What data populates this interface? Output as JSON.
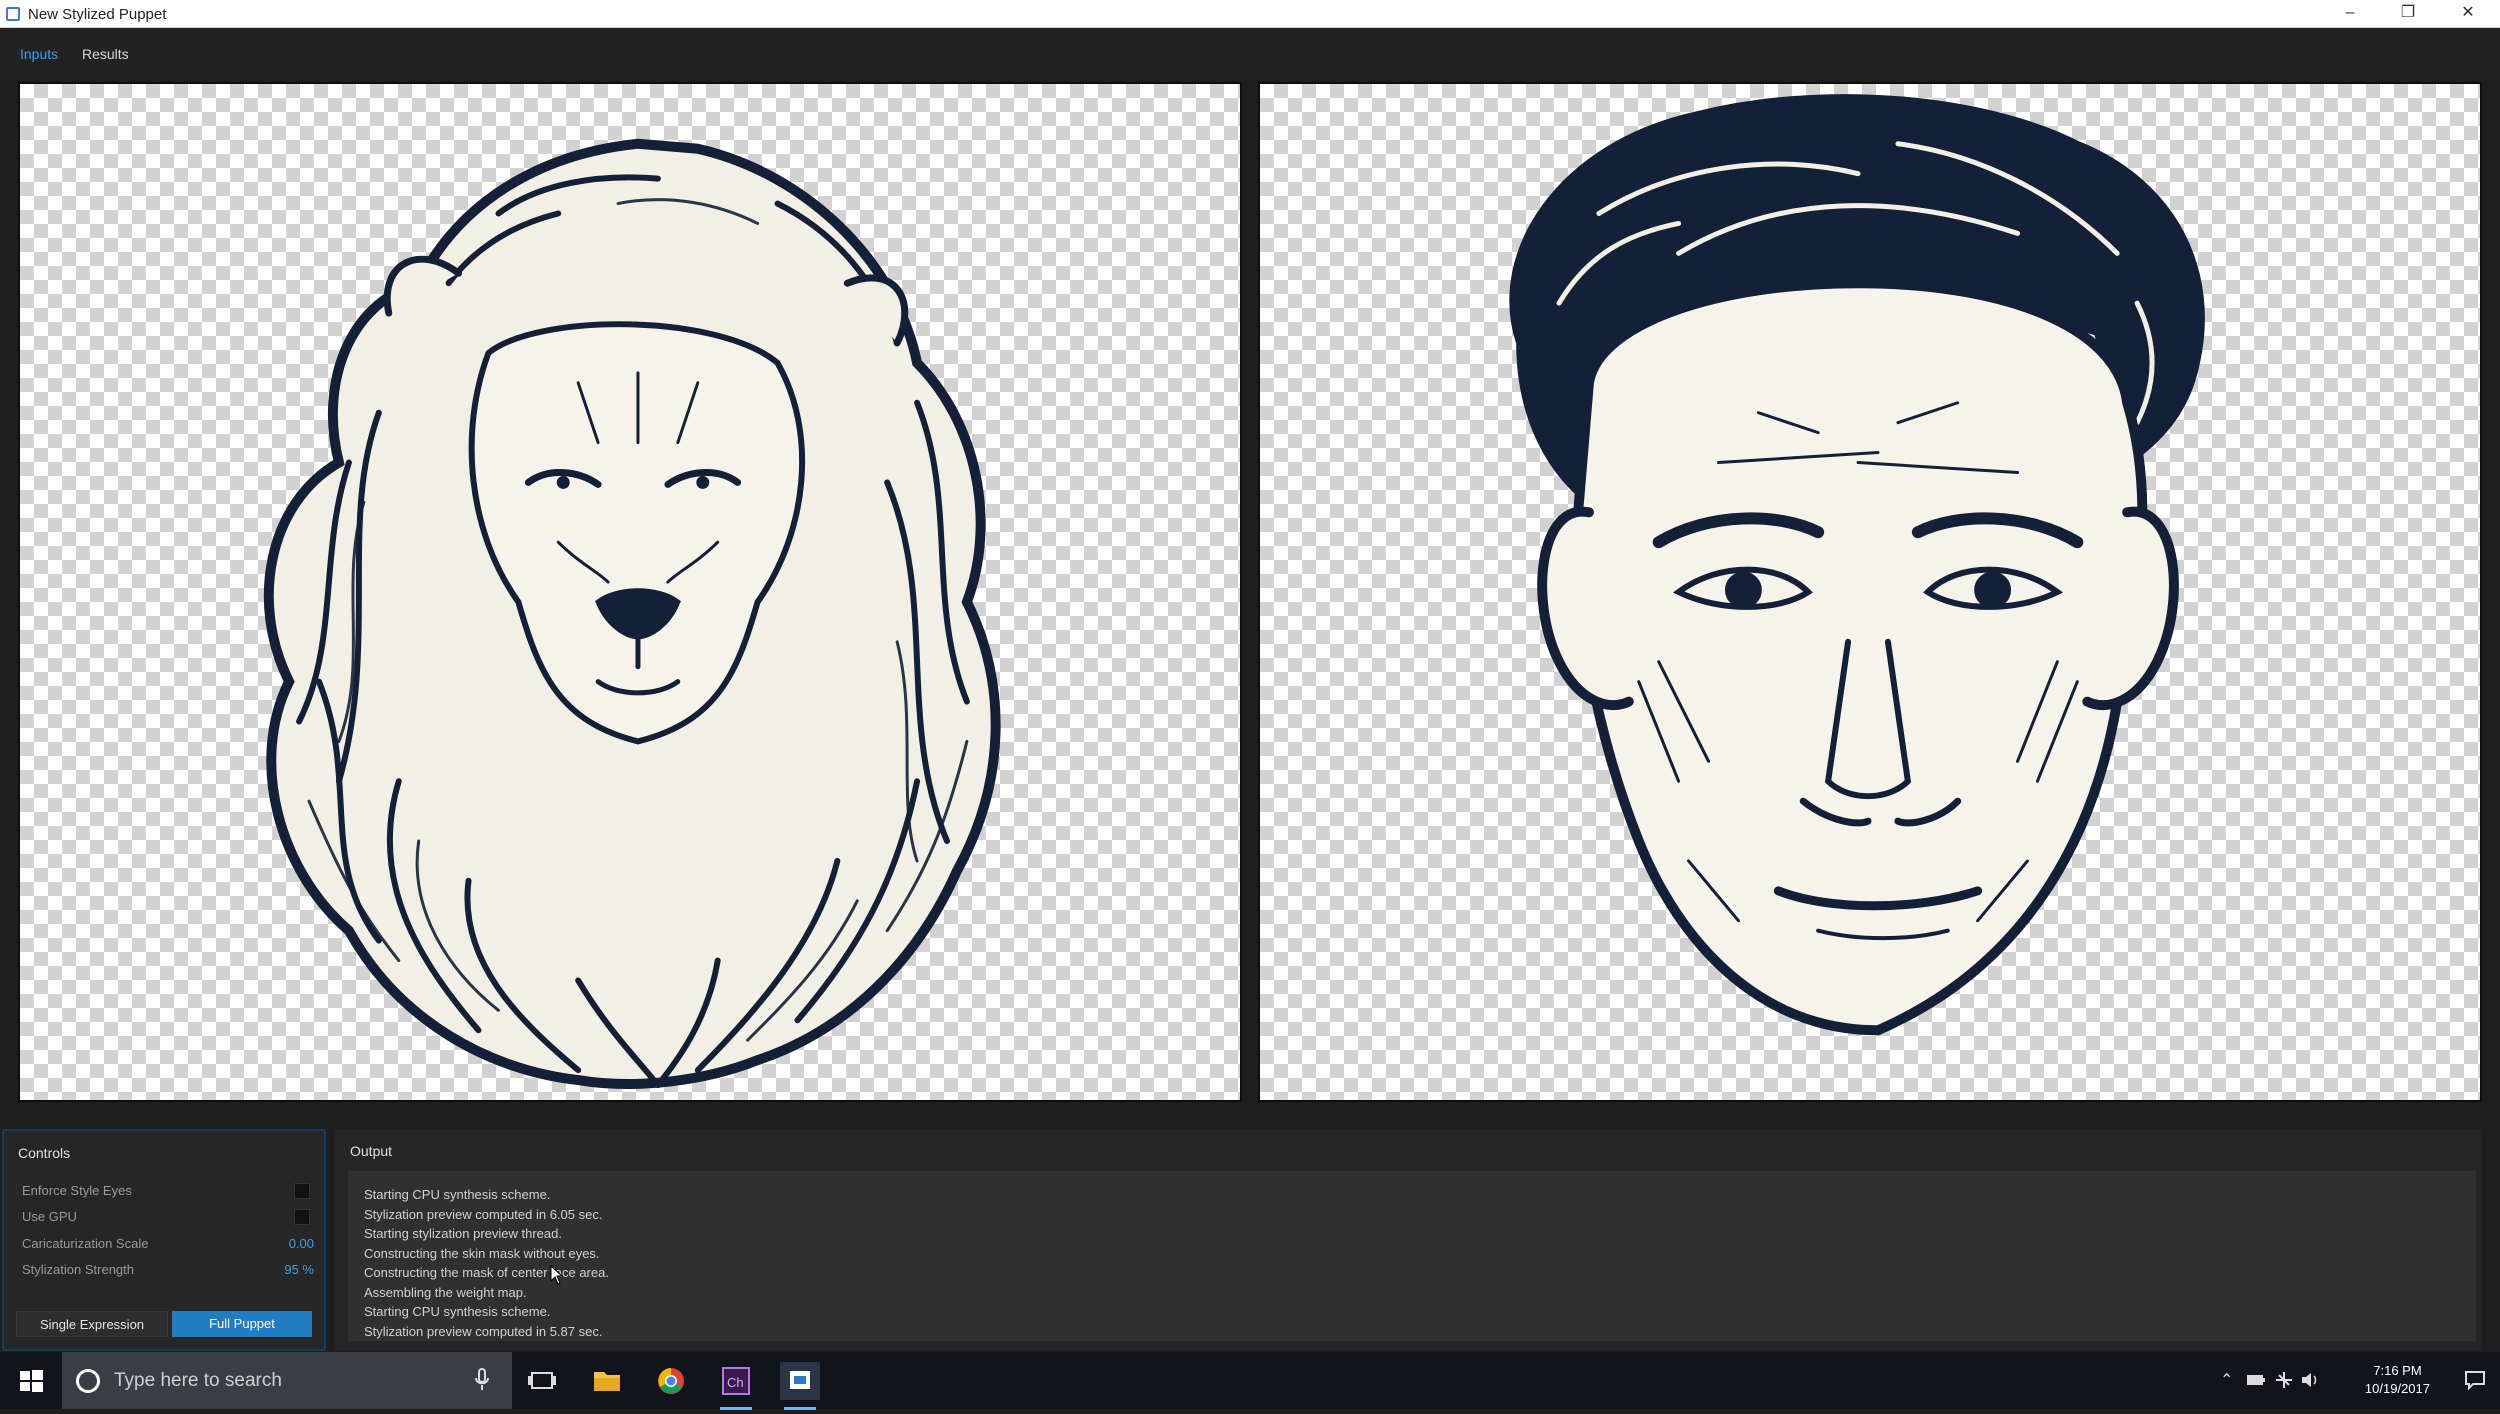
{
  "window": {
    "title": "New Stylized Puppet",
    "minimize_glyph": "–",
    "restore_glyph": "❐",
    "close_glyph": "✕"
  },
  "tabs": [
    {
      "label": "Inputs",
      "active": true
    },
    {
      "label": "Results",
      "active": false
    }
  ],
  "panels": {
    "left": {
      "content": "lion-illustration"
    },
    "right": {
      "content": "stylized-face-illustration"
    }
  },
  "controls": {
    "header": "Controls",
    "enforce_style_eyes": {
      "label": "Enforce Style Eyes",
      "checked": false
    },
    "use_gpu": {
      "label": "Use GPU",
      "checked": false
    },
    "caricaturization_scale": {
      "label": "Caricaturization Scale",
      "value": "0.00"
    },
    "stylization_strength": {
      "label": "Stylization Strength",
      "value": "95 %"
    },
    "single_expression_label": "Single Expression",
    "full_puppet_label": "Full Puppet",
    "accent_color": "#1f7ec4"
  },
  "output": {
    "header": "Output",
    "lines": [
      "Starting CPU synthesis scheme.",
      "Stylization preview computed in 6.05 sec.",
      "Starting stylization preview thread.",
      "Constructing the skin mask without eyes.",
      "Constructing the mask of center face area.",
      "Assembling the weight map.",
      "Starting CPU synthesis scheme.",
      "Stylization preview computed in 5.87 sec."
    ]
  },
  "taskbar": {
    "search_placeholder": "Type here to search",
    "apps": [
      "task-view-icon",
      "file-explorer-icon",
      "chrome-icon",
      "character-animator-icon",
      "puppet-app-icon"
    ],
    "time": "7:16 PM",
    "date": "10/19/2017"
  }
}
